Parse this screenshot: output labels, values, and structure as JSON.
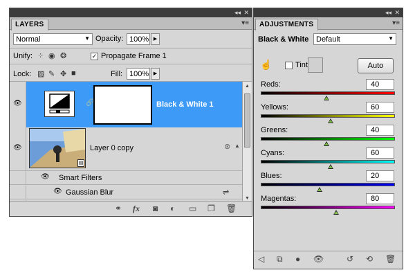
{
  "layers_panel": {
    "tab_label": "LAYERS",
    "blend_mode": "Normal",
    "opacity_label": "Opacity:",
    "opacity_value": "100%",
    "unify_label": "Unify:",
    "propagate_label": "Propagate Frame 1",
    "propagate_checked": true,
    "lock_label": "Lock:",
    "fill_label": "Fill:",
    "fill_value": "100%",
    "layers": [
      {
        "name": "Black & White 1",
        "selected": true,
        "visible": true
      },
      {
        "name": "Layer 0 copy",
        "selected": false,
        "visible": true
      },
      {
        "name": "Smart Filters",
        "selected": false,
        "visible": true
      },
      {
        "name": "Gaussian Blur",
        "selected": false,
        "visible": true
      }
    ],
    "selection_color": "#3d9bf7"
  },
  "adjustments_panel": {
    "tab_label": "ADJUSTMENTS",
    "title": "Black & White",
    "preset": "Default",
    "tint_label": "Tint",
    "tint_checked": false,
    "auto_label": "Auto",
    "sliders": [
      {
        "label": "Reds:",
        "value": "40",
        "gradient": [
          "#000000",
          "#ff0000"
        ],
        "fraction": 0.49
      },
      {
        "label": "Yellows:",
        "value": "60",
        "gradient": [
          "#000000",
          "#ffff00"
        ],
        "fraction": 0.52
      },
      {
        "label": "Greens:",
        "value": "40",
        "gradient": [
          "#000000",
          "#00ff00"
        ],
        "fraction": 0.49
      },
      {
        "label": "Cyans:",
        "value": "60",
        "gradient": [
          "#000000",
          "#00ffff"
        ],
        "fraction": 0.52
      },
      {
        "label": "Blues:",
        "value": "20",
        "gradient": [
          "#000000",
          "#0000ff"
        ],
        "fraction": 0.44
      },
      {
        "label": "Magentas:",
        "value": "80",
        "gradient": [
          "#000000",
          "#ff00ff"
        ],
        "fraction": 0.56
      }
    ]
  }
}
